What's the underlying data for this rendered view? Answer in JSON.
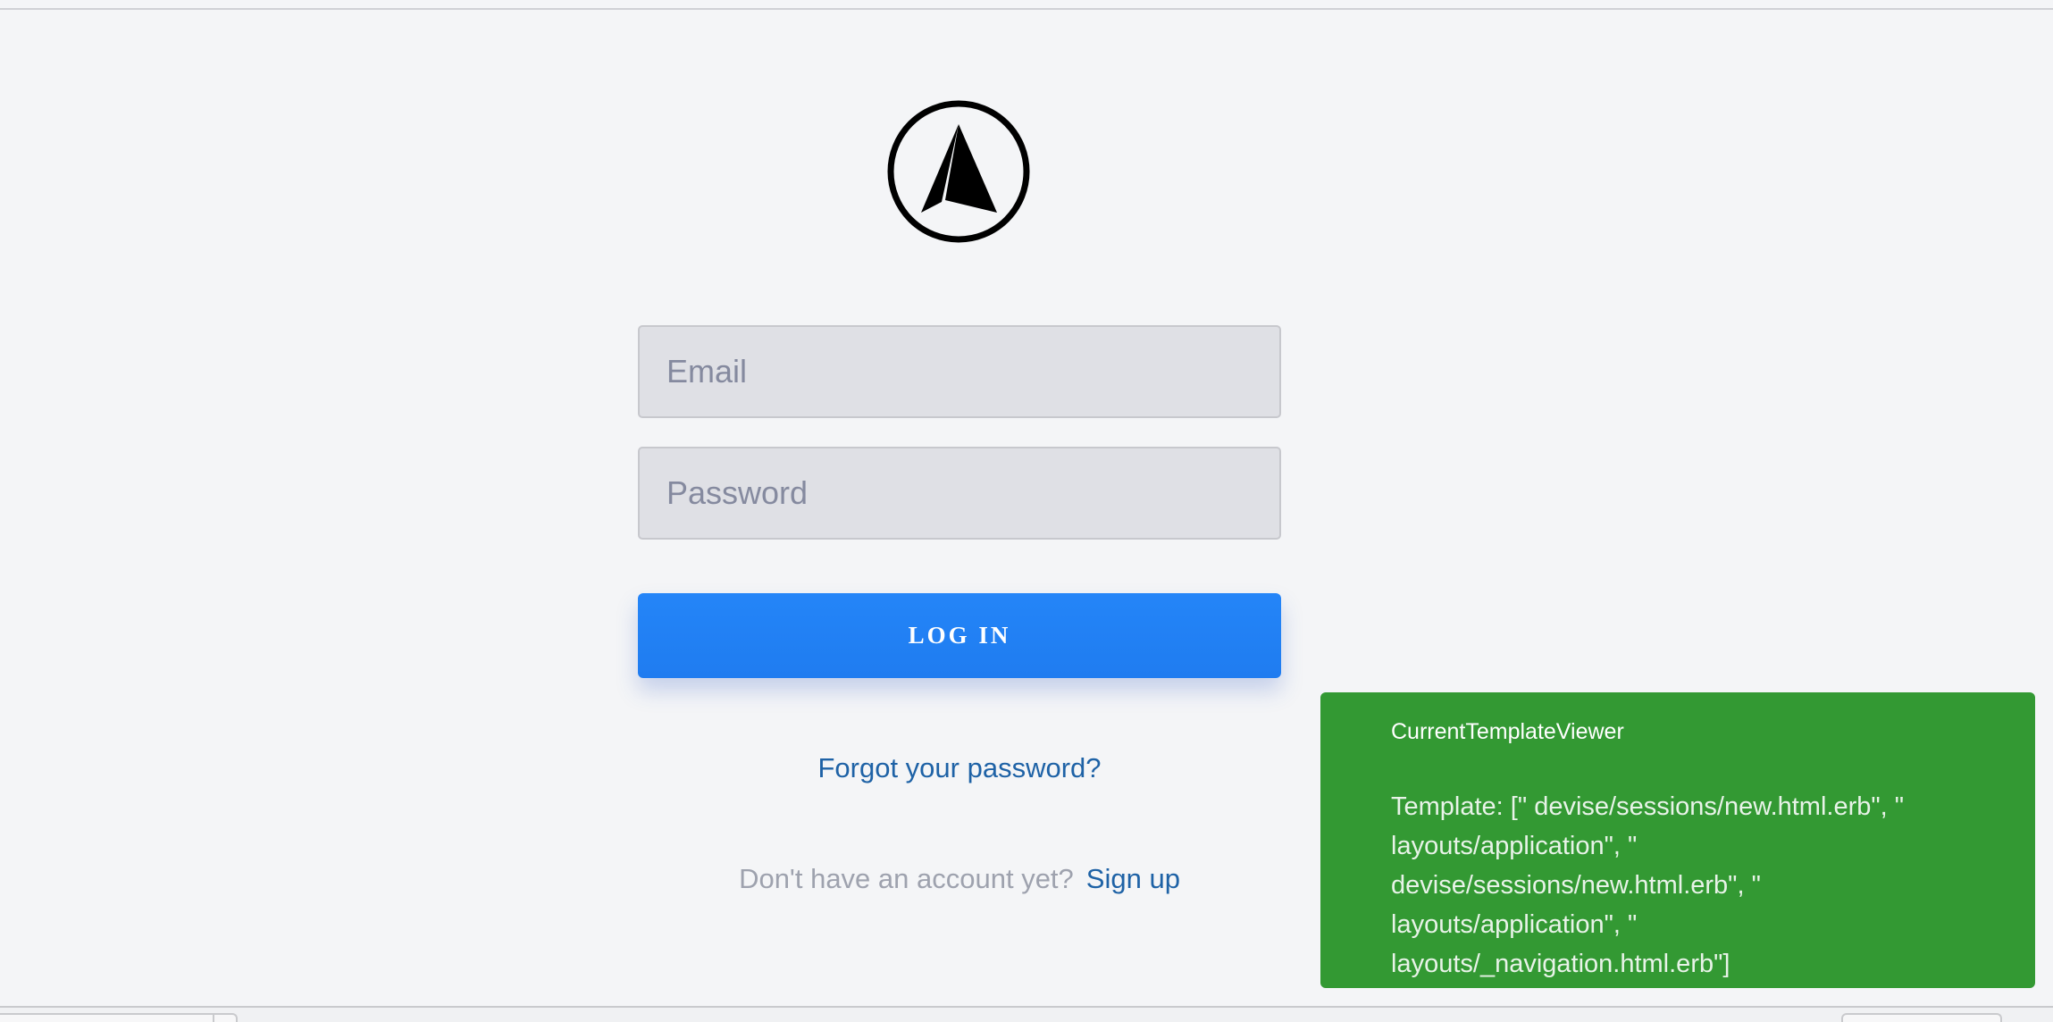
{
  "login_form": {
    "email_placeholder": "Email",
    "password_placeholder": "Password",
    "submit_label": "LOG IN",
    "forgot_password_link": "Forgot your password?",
    "signup_prompt": "Don't have an account yet?",
    "signup_link": "Sign up"
  },
  "template_viewer": {
    "title": "CurrentTemplateViewer",
    "body": "Template: [\" devise/sessions/new.html.erb\", \" layouts/application\", \" devise/sessions/new.html.erb\", \" layouts/application\", \" layouts/_navigation.html.erb\"]"
  },
  "colors": {
    "page_background": "#f4f5f7",
    "button_blue": "#2082f5",
    "link_blue": "#1e62a6",
    "viewer_green": "#339933"
  },
  "icons": {
    "logo": "compass-arrow-icon"
  }
}
